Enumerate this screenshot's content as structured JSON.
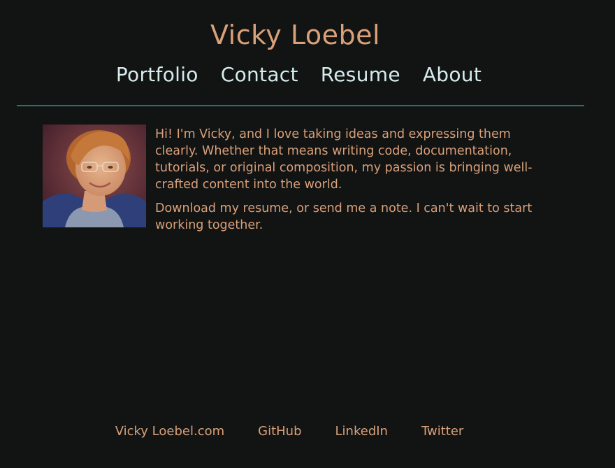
{
  "header": {
    "title": "Vicky Loebel"
  },
  "nav": {
    "items": [
      {
        "label": "Portfolio"
      },
      {
        "label": "Contact"
      },
      {
        "label": "Resume"
      },
      {
        "label": "About"
      }
    ]
  },
  "main": {
    "avatar_alt": "Photo of Vicky Loebel",
    "paragraphs": [
      "Hi! I'm Vicky, and I love taking ideas and expressing them clearly. Whether that means writing code, documentation, tutorials, or original composition, my passion is bringing well-crafted content into the world.",
      "Download my resume, or send me a note. I can't wait to start working together."
    ]
  },
  "footer": {
    "links": [
      {
        "label": "Vicky Loebel.com"
      },
      {
        "label": "GitHub"
      },
      {
        "label": "LinkedIn"
      },
      {
        "label": "Twitter"
      }
    ]
  },
  "colors": {
    "background": "#121313",
    "accent_text": "#d9a07a",
    "nav_text": "#d6ecec",
    "divider": "#2b6f73"
  }
}
